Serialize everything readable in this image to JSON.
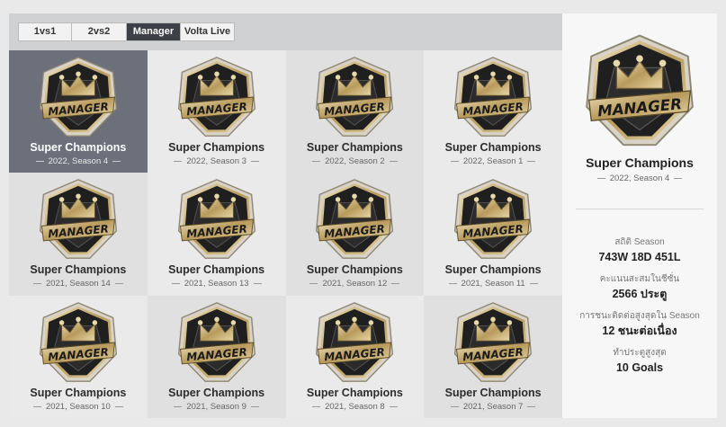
{
  "tabs": [
    {
      "label": "1vs1",
      "active": false
    },
    {
      "label": "2vs2",
      "active": false
    },
    {
      "label": "Manager",
      "active": true
    },
    {
      "label": "Volta Live",
      "active": false
    }
  ],
  "badge_text": "MANAGER",
  "icon": "manager-crown-badge-icon",
  "colors": {
    "selected_cell": "#6c707a",
    "cell_light": "#eaeaea",
    "cell_dark": "#dcdcdc",
    "badge_gold": "#c9b27a",
    "badge_dark": "#1e1e1e",
    "active_tab": "#3d4046"
  },
  "grid": [
    {
      "title": "Super Champions",
      "subtitle": "2022, Season 4",
      "selected": true
    },
    {
      "title": "Super Champions",
      "subtitle": "2022, Season 3",
      "selected": false
    },
    {
      "title": "Super Champions",
      "subtitle": "2022, Season 2",
      "selected": false
    },
    {
      "title": "Super Champions",
      "subtitle": "2022, Season 1",
      "selected": false
    },
    {
      "title": "Super Champions",
      "subtitle": "2021, Season 14",
      "selected": false
    },
    {
      "title": "Super Champions",
      "subtitle": "2021, Season 13",
      "selected": false
    },
    {
      "title": "Super Champions",
      "subtitle": "2021, Season 12",
      "selected": false
    },
    {
      "title": "Super Champions",
      "subtitle": "2021, Season 11",
      "selected": false
    },
    {
      "title": "Super Champions",
      "subtitle": "2021, Season 10",
      "selected": false
    },
    {
      "title": "Super Champions",
      "subtitle": "2021, Season 9",
      "selected": false
    },
    {
      "title": "Super Champions",
      "subtitle": "2021, Season 8",
      "selected": false
    },
    {
      "title": "Super Champions",
      "subtitle": "2021, Season 7",
      "selected": false
    }
  ],
  "detail": {
    "title": "Super Champions",
    "subtitle": "2022, Season 4",
    "stats": [
      {
        "label": "สถิติ Season",
        "value": "743W 18D 451L"
      },
      {
        "label": "คะแนนสะสมในชีซั่น",
        "value": "2566 ประตู"
      },
      {
        "label": "การชนะติดต่อสูงสุดใน Season",
        "value": "12 ชนะต่อเนื่อง"
      },
      {
        "label": "ทำประตูสูงสุด",
        "value": "10 Goals"
      }
    ]
  }
}
